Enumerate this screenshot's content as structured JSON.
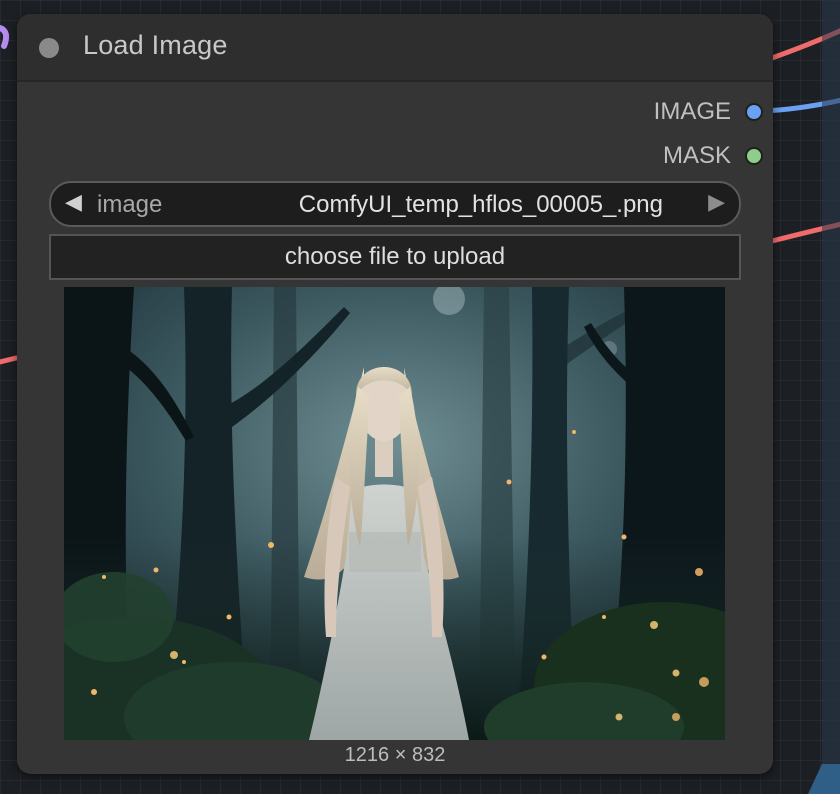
{
  "node": {
    "title": "Load Image",
    "outputs": [
      {
        "label": "IMAGE",
        "color": "#6aa1f2"
      },
      {
        "label": "MASK",
        "color": "#8fce8a"
      }
    ],
    "image_widget": {
      "label": "image",
      "value": "ComfyUI_temp_hflos_00005_.png",
      "prev_arrow": "◀",
      "next_arrow": "▶"
    },
    "upload_label": "choose file to upload",
    "preview_dimensions": "1216 × 832"
  },
  "colors": {
    "wire_red": "#f06b6b",
    "wire_blue": "#6aa1f2",
    "wire_purple": "#b58cf0",
    "node_body": "#353535",
    "node_title": "#2e2e2e"
  }
}
